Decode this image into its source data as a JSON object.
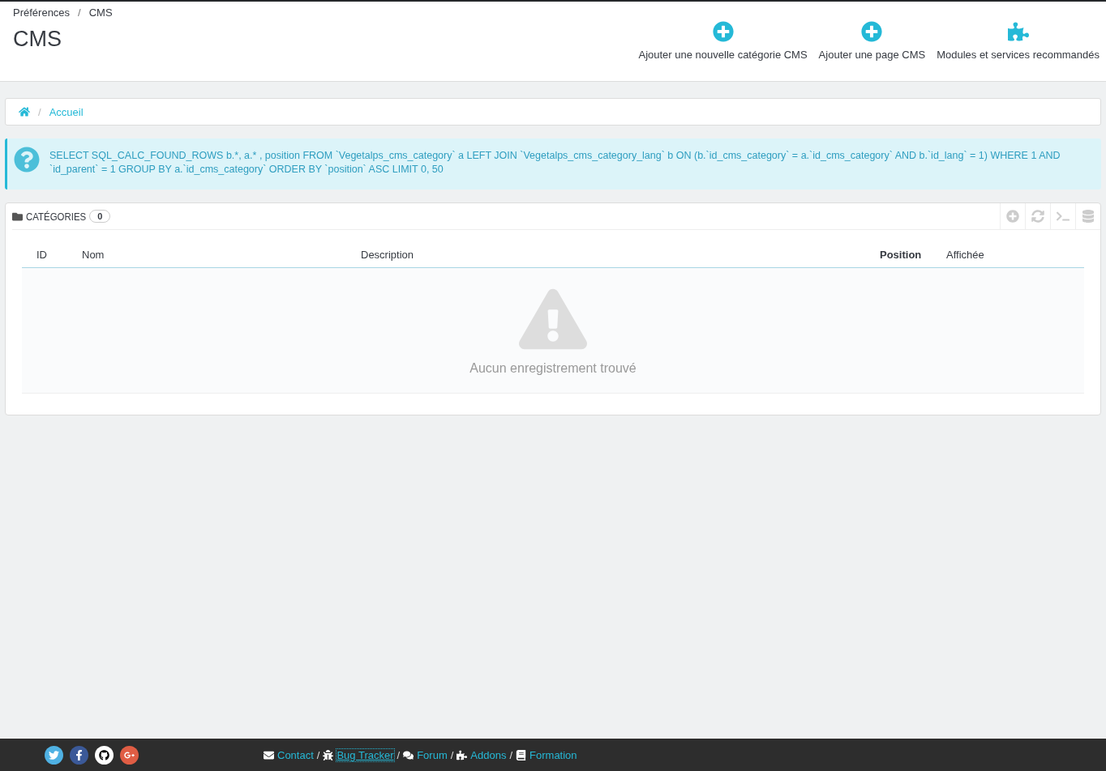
{
  "breadcrumb": {
    "separator": "/",
    "items": [
      "Préférences",
      "CMS"
    ]
  },
  "title": "CMS",
  "toolbar": [
    {
      "kind": "add",
      "label": "Ajouter une nouvelle catégorie CMS"
    },
    {
      "kind": "add",
      "label": "Ajouter une page CMS"
    },
    {
      "kind": "modules",
      "label": "Modules et services recommandés"
    }
  ],
  "path_bar": {
    "separator": "/",
    "items": [
      {
        "kind": "home"
      },
      {
        "kind": "link",
        "label": "Accueil"
      }
    ]
  },
  "info": "SELECT SQL_CALC_FOUND_ROWS b.*, a.* , position FROM `Vegetalps_cms_category` a LEFT JOIN `Vegetalps_cms_category_lang` b ON (b.`id_cms_category` = a.`id_cms_category` AND b.`id_lang` = 1) WHERE 1 AND `id_parent` = 1 GROUP BY a.`id_cms_category` ORDER BY `position` ASC LIMIT 0, 50",
  "panel": {
    "title": "CATÉGORIES",
    "count": "0",
    "actions": [
      {
        "kind": "add"
      },
      {
        "kind": "refresh"
      },
      {
        "kind": "sql"
      },
      {
        "kind": "export"
      }
    ],
    "columns": [
      {
        "label": "ID",
        "sorted": false
      },
      {
        "label": "Nom",
        "sorted": false
      },
      {
        "label": "Description",
        "sorted": false
      },
      {
        "label": "Position",
        "sorted": true
      },
      {
        "label": "Affichée",
        "sorted": false
      }
    ],
    "empty_message": "Aucun enregistrement trouvé"
  },
  "footer": {
    "social": [
      {
        "kind": "twitter"
      },
      {
        "kind": "facebook"
      },
      {
        "kind": "github"
      },
      {
        "kind": "googleplus"
      }
    ],
    "separator": "/",
    "links": [
      {
        "kind": "contact",
        "label": "Contact",
        "focused": false
      },
      {
        "kind": "bug",
        "label": "Bug Tracker",
        "focused": true
      },
      {
        "kind": "forum",
        "label": "Forum",
        "focused": false
      },
      {
        "kind": "addons",
        "label": "Addons",
        "focused": false
      },
      {
        "kind": "training",
        "label": "Formation",
        "focused": false
      }
    ]
  }
}
